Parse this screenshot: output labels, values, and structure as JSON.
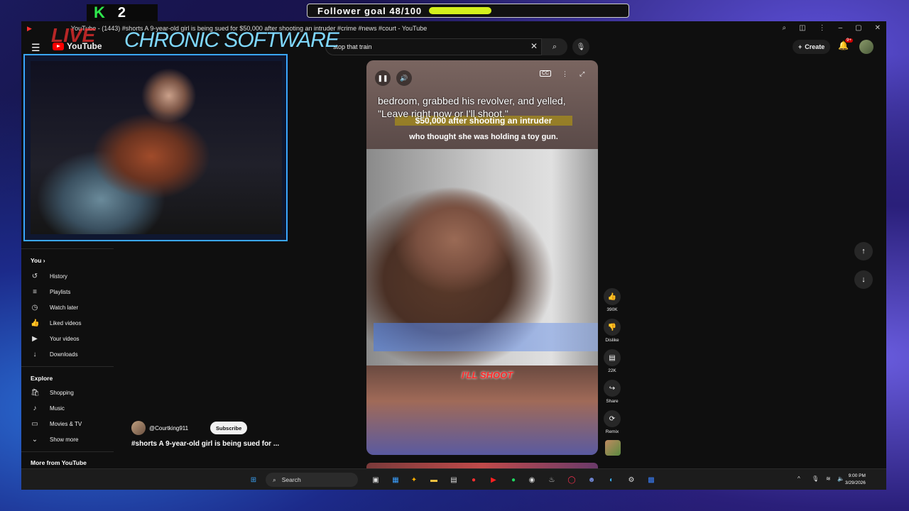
{
  "overlay": {
    "counter_logo": "K",
    "counter_value": "2",
    "follower_goal": "Follower goal 48/100",
    "follower_progress": 0.48,
    "live_text": "LIVE",
    "stream_title": "CHRONIC SOFTWARE"
  },
  "window": {
    "title": "YouTube - (1443) #shorts A 9-year-old girl is being sued for $50,000 after shooting an intruder #crime #news #court - YouTube"
  },
  "header": {
    "logo_text": "YouTube",
    "search_value": "stop that train",
    "create_label": "Create",
    "notification_badge": "9+"
  },
  "sidebar": {
    "you_label": "You",
    "you_items": [
      {
        "label": "History",
        "icon": "history-icon"
      },
      {
        "label": "Playlists",
        "icon": "playlists-icon"
      },
      {
        "label": "Watch later",
        "icon": "watch-later-icon"
      },
      {
        "label": "Liked videos",
        "icon": "liked-videos-icon"
      },
      {
        "label": "Your videos",
        "icon": "your-videos-icon"
      },
      {
        "label": "Downloads",
        "icon": "downloads-icon"
      }
    ],
    "explore_label": "Explore",
    "explore_items": [
      {
        "label": "Shopping",
        "icon": "shopping-icon"
      },
      {
        "label": "Music",
        "icon": "music-icon"
      },
      {
        "label": "Movies & TV",
        "icon": "movies-icon"
      },
      {
        "label": "Show more",
        "icon": "chevron-down-icon"
      }
    ],
    "more_label": "More from YouTube"
  },
  "video": {
    "caption_line1": "bedroom, grabbed his revolver, and yelled, \"Leave right now or I'll shoot.\"",
    "caption_line2": "$50,000 after shooting an intruder",
    "caption_line3": "who thought she was holding a toy gun.",
    "overlay_text": "I'LL SHOOT",
    "cc_label": "CC"
  },
  "actions": {
    "like_count": "390K",
    "dislike_label": "Dislike",
    "comment_count": "22K",
    "share_label": "Share",
    "remix_label": "Remix"
  },
  "channel": {
    "handle": "@Courtking911",
    "subscribe_label": "Subscribe",
    "short_title": "#shorts A 9-year-old girl is being sued for ..."
  },
  "taskbar": {
    "search_label": "Search",
    "time": "9:00 PM",
    "date": "3/29/2026"
  },
  "colors": {
    "accent_red": "#ff0000",
    "goal_bar": "#d4f01c",
    "cam_border": "#3aa7ff"
  }
}
